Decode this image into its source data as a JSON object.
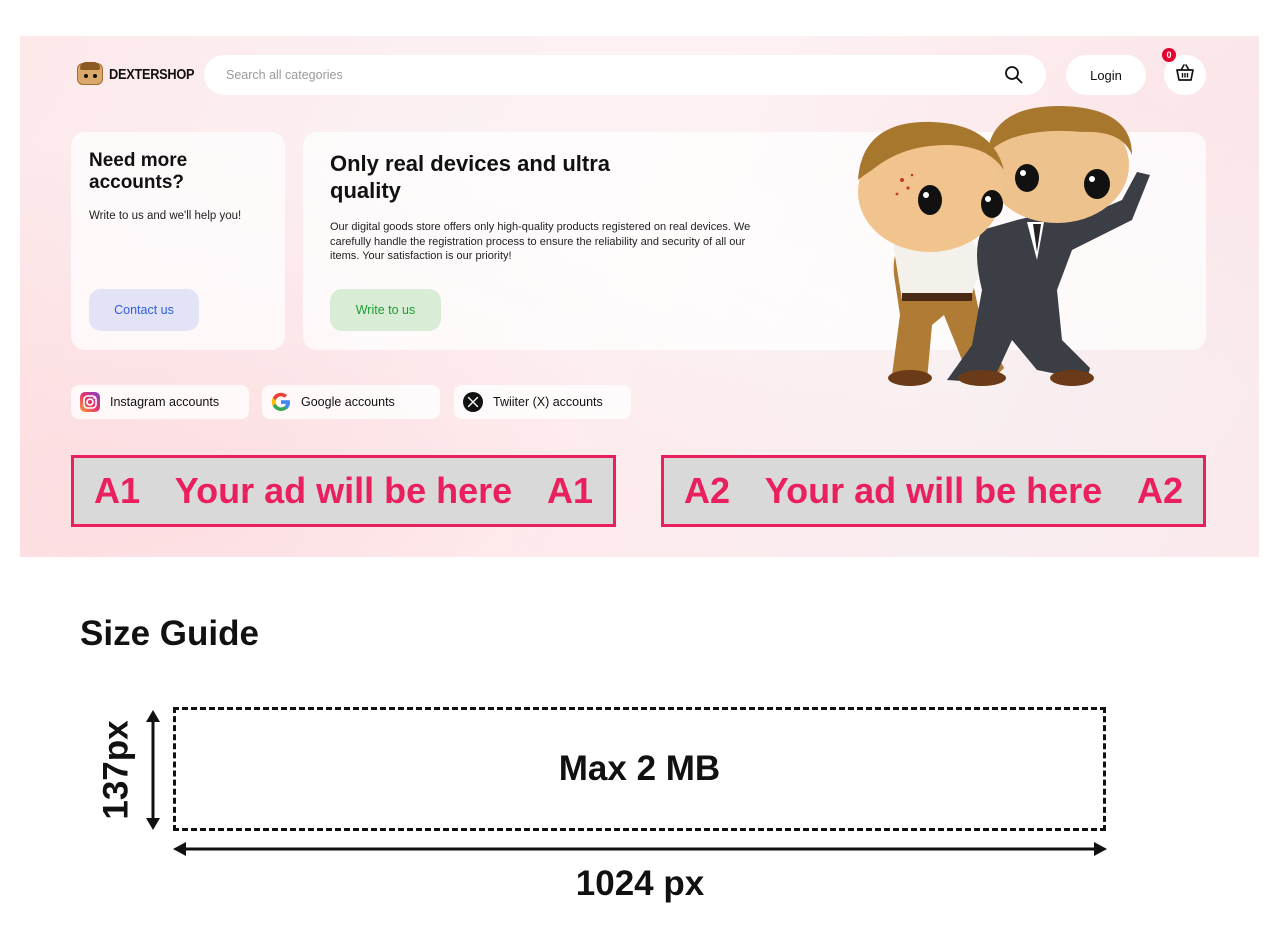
{
  "header": {
    "logo_text": "DEXTERSHOP",
    "search_placeholder": "Search all categories",
    "login_label": "Login",
    "cart_count": "0"
  },
  "promo_card": {
    "title": "Need more accounts?",
    "text": "Write to us and we'll help you!",
    "button_label": "Contact us"
  },
  "hero": {
    "title": "Only real devices and ultra quality",
    "text": "Our digital goods store offers only high-quality products registered on real devices. We carefully handle the registration process to ensure the reliability and security of all our items. Your satisfaction is our priority!",
    "button_label": "Write to us"
  },
  "categories": [
    {
      "label": "Instagram accounts",
      "icon": "instagram-icon"
    },
    {
      "label": "Google accounts",
      "icon": "google-icon"
    },
    {
      "label": "Twiiter (X) accounts",
      "icon": "x-icon"
    }
  ],
  "ads": [
    {
      "tag": "A1",
      "text": "Your ad will be here"
    },
    {
      "tag": "A2",
      "text": "Your ad will be here"
    }
  ],
  "size_guide": {
    "title": "Size Guide",
    "box_label": "Max 2 MB",
    "height_label": "137px",
    "width_label": "1024 px"
  },
  "colors": {
    "ad_accent": "#ea1f5e",
    "ad_background": "#d9d9d9",
    "contact_button_bg": "#e3e3f8",
    "contact_button_text": "#2f5ee0",
    "write_button_bg": "#d8ecd6",
    "write_button_text": "#1f9d33",
    "cart_badge": "#e4002b"
  }
}
